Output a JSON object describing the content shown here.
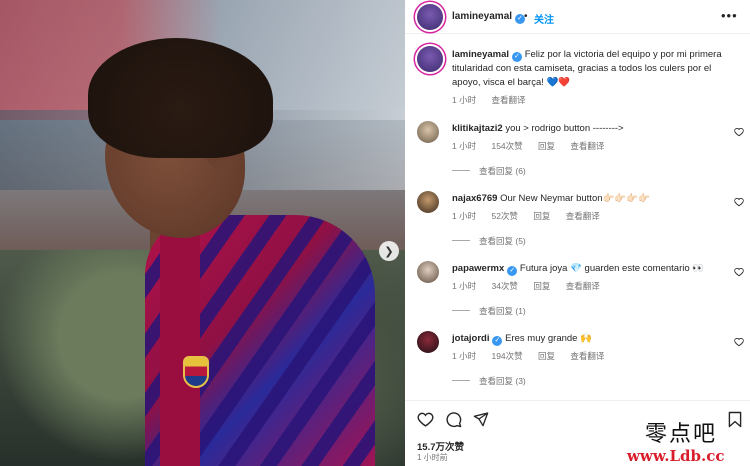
{
  "post": {
    "username": "lamineyamal",
    "follow_label": "关注",
    "more_label": "•••",
    "dot": "•"
  },
  "caption": {
    "username": "lamineyamal",
    "text": "Feliz por la victoria del equipo y por mi primera titularidad con esta camiseta, gracias a todos los culers por el apoyo, visca el barça! 💙❤️",
    "time": "1 小时",
    "translate": "查看翻译"
  },
  "comments": [
    {
      "username": "klitikajtazi2",
      "verified": false,
      "text": "you > rodrigo button -------->",
      "time": "1 小时",
      "likes": "154次赞",
      "reply": "回复",
      "translate": "查看翻译",
      "replies": "查看回复 (6)"
    },
    {
      "username": "najax6769",
      "verified": false,
      "text": "Our New Neymar button👉🏻👉🏻👉🏻👉🏻",
      "time": "1 小时",
      "likes": "52次赞",
      "reply": "回复",
      "translate": "查看翻译",
      "replies": "查看回复 (5)"
    },
    {
      "username": "papawermx",
      "verified": true,
      "text": "Futura joya 💎 guarden este comentario 👀",
      "time": "1 小时",
      "likes": "34次赞",
      "reply": "回复",
      "translate": "查看翻译",
      "replies": "查看回复 (1)"
    },
    {
      "username": "jotajordi",
      "verified": true,
      "text": "Eres muy grande 🙌",
      "time": "1 小时",
      "likes": "194次赞",
      "reply": "回复",
      "translate": "查看翻译",
      "replies": "查看回复 (3)"
    }
  ],
  "footer": {
    "likes": "15.7万次赞",
    "time": "1 小时前"
  },
  "watermark": {
    "cn": "零点吧",
    "url": "www.Ldb.cc"
  },
  "colors": {
    "accent": "#0095f6",
    "verified": "#3897f0",
    "muted": "#737373",
    "watermark_red": "#d81e2a"
  },
  "icons": [
    "verified-badge-icon",
    "heart-icon",
    "comment-icon",
    "share-icon",
    "bookmark-icon",
    "chevron-right-icon",
    "more-icon"
  ]
}
